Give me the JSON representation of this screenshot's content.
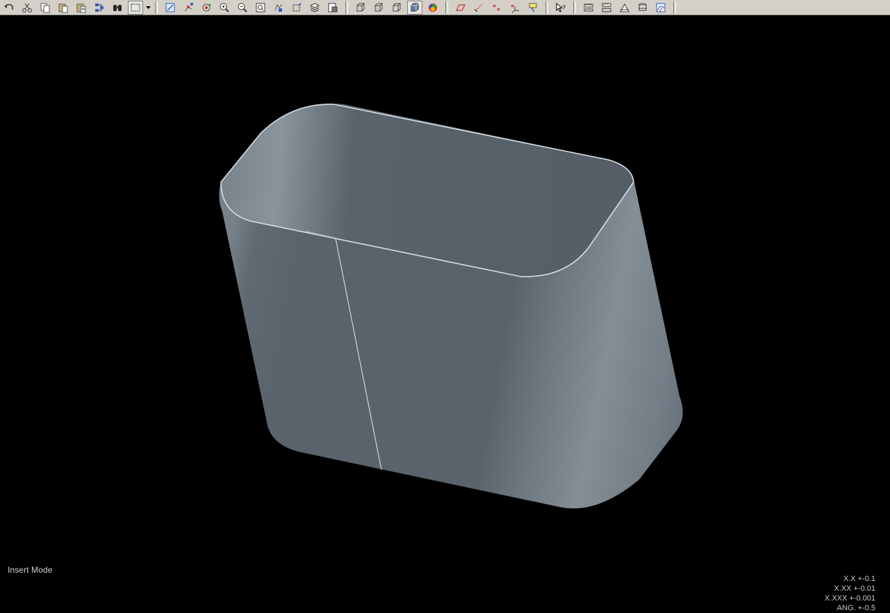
{
  "toolbar": {
    "groups": [
      {
        "name": "edit",
        "icons": [
          "undo-icon",
          "cut-icon",
          "copy-icon",
          "paste-icon",
          "paste-special-icon",
          "regenerate-icon",
          "find-icon",
          "selection-box-icon"
        ]
      },
      {
        "name": "view",
        "icons": [
          "sketch-icon",
          "datum-axis-icon",
          "spin-center-icon",
          "zoom-in-icon",
          "zoom-out-icon",
          "refit-icon",
          "reorient-icon",
          "saved-views-icon",
          "layers-icon",
          "view-manager-icon"
        ]
      },
      {
        "name": "display",
        "icons": [
          "wireframe-icon",
          "hidden-line-icon",
          "no-hidden-icon",
          "shading-icon",
          "appearance-icon"
        ]
      },
      {
        "name": "datum",
        "icons": [
          "datum-planes-icon",
          "datum-axes-icon",
          "datum-points-icon",
          "coordinate-systems-icon",
          "annotations-icon"
        ]
      },
      {
        "name": "help",
        "icons": [
          "context-help-icon"
        ]
      },
      {
        "name": "analysis",
        "icons": [
          "measure-icon",
          "model-analysis-icon",
          "draft-icon",
          "section-icon",
          "curvature-icon"
        ]
      }
    ],
    "active_icon": "shading-icon"
  },
  "status": {
    "mode": "Insert Mode"
  },
  "tolerances": {
    "one_decimal": "X.X +-0.1",
    "two_decimal": "X.XX +-0.01",
    "three_decimal": "X.XXX +-0.001",
    "angular": "ANG. +-0.5"
  },
  "colors": {
    "background": "#000000",
    "model": "#5a636b",
    "toolbar": "#d4d0c8",
    "edge": "#d8e0e6"
  }
}
